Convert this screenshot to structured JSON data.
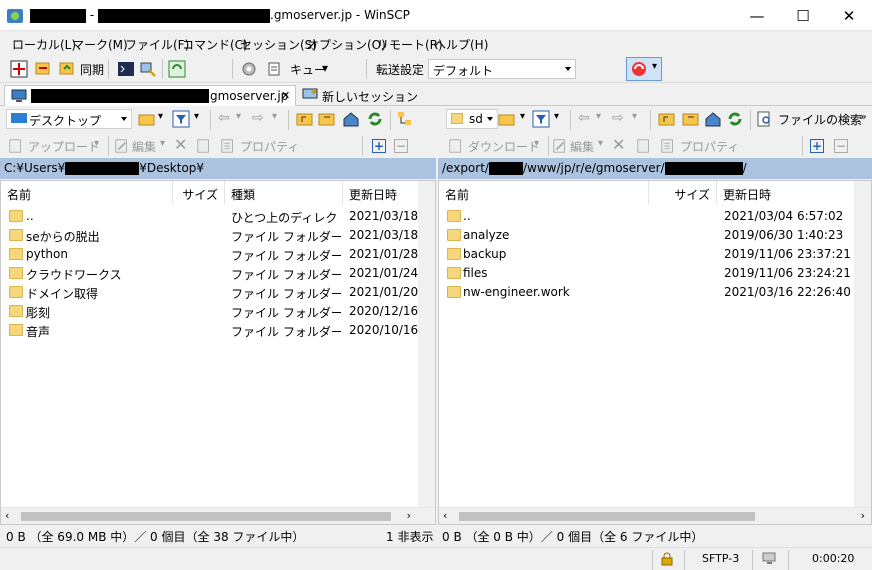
{
  "window": {
    "title_suffix": ".gmoserver.jp - WinSCP",
    "title_dash": "-",
    "minimize": "—",
    "maximize": "☐",
    "close": "✕"
  },
  "menu": [
    "ローカル(L)",
    "マーク(M)",
    "ファイル(F)",
    "コマンド(C)",
    "セッション(S)",
    "オプション(O)",
    "リモート(R)",
    "ヘルプ(H)"
  ],
  "toolbar": {
    "sync_label": "同期",
    "queue_label": "キュー",
    "transfer_label": "転送設定",
    "transfer_value": "デフォルト"
  },
  "tabs": {
    "session_suffix": "gmoserver.jp",
    "session_close": "✕",
    "new_session": "新しいセッション"
  },
  "local": {
    "drive": "デスクトップ",
    "upload": "アップロード",
    "edit": "編集",
    "properties": "プロパティ",
    "path_prefix": "C:¥Users¥",
    "path_suffix": "¥Desktop¥",
    "columns": [
      "名前",
      "サイズ",
      "種類",
      "更新日時"
    ],
    "rows": [
      {
        "name": "..",
        "size": "",
        "type": "ひとつ上のディレクトリ",
        "date": "2021/03/18"
      },
      {
        "name": "seからの脱出",
        "size": "",
        "type": "ファイル フォルダー",
        "date": "2021/03/18"
      },
      {
        "name": "python",
        "size": "",
        "type": "ファイル フォルダー",
        "date": "2021/01/28"
      },
      {
        "name": "クラウドワークス",
        "size": "",
        "type": "ファイル フォルダー",
        "date": "2021/01/24"
      },
      {
        "name": "ドメイン取得",
        "size": "",
        "type": "ファイル フォルダー",
        "date": "2021/01/20"
      },
      {
        "name": "彫刻",
        "size": "",
        "type": "ファイル フォルダー",
        "date": "2020/12/16"
      },
      {
        "name": "音声",
        "size": "",
        "type": "ファイル フォルダー",
        "date": "2020/10/16"
      }
    ],
    "status": "0 B （全 69.0 MB 中）／ 0 個目（全 38 ファイル中）",
    "hidden": "1 非表示"
  },
  "remote": {
    "drive": "sd",
    "download": "ダウンロード",
    "edit": "編集",
    "properties": "プロパティ",
    "find": "ファイルの検索",
    "path_prefix": "/export/",
    "path_middle": "/www/jp/r/e/gmoserver/",
    "path_suffix": "/",
    "columns": [
      "名前",
      "サイズ",
      "更新日時"
    ],
    "rows": [
      {
        "name": "..",
        "size": "",
        "date": "2021/03/04 6:57:02"
      },
      {
        "name": "analyze",
        "size": "",
        "date": "2019/06/30 1:40:23"
      },
      {
        "name": "backup",
        "size": "",
        "date": "2019/11/06 23:37:21"
      },
      {
        "name": "files",
        "size": "",
        "date": "2019/11/06 23:24:21"
      },
      {
        "name": "nw-engineer.work",
        "size": "",
        "date": "2021/03/16 22:26:40"
      }
    ],
    "status": "0 B （全 0 B 中）／ 0 個目（全 6 ファイル中）"
  },
  "statusbar": {
    "protocol": "SFTP-3",
    "elapsed": "0:00:20"
  }
}
